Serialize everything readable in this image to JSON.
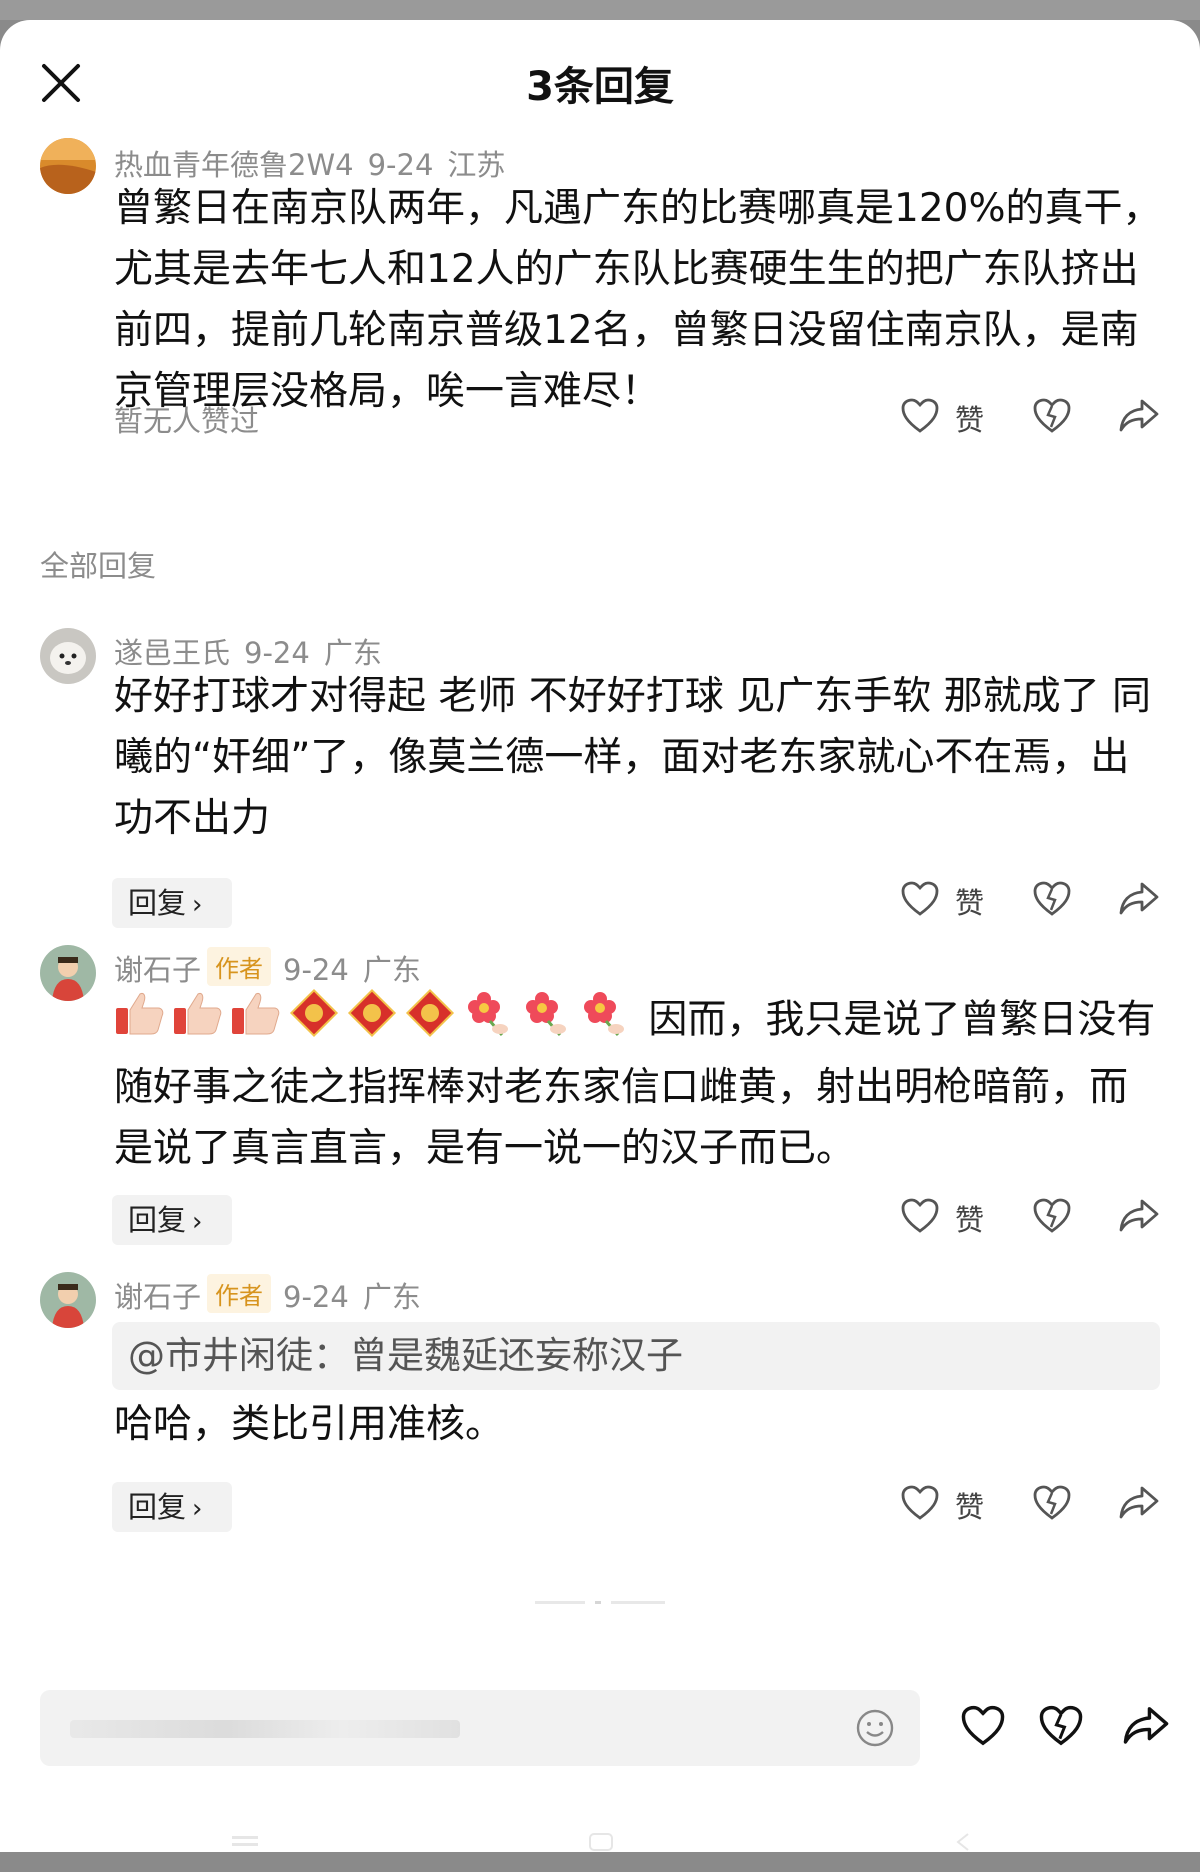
{
  "header": {
    "title": "3条回复"
  },
  "main_comment": {
    "user": "热血青年德鲁2W4",
    "date": "9-24",
    "location": "江苏",
    "text": "曾繁日在南京队两年，凡遇广东的比赛哪真是120%的真干，尤其是去年七人和12人的广东队比赛硬生生的把广东队挤出前四，提前几轮南京普级12名，曾繁日没留住南京队，是南京管理层没格局，唉一言难尽！",
    "likes_text": "暂无人赞过",
    "like_label": "赞"
  },
  "section_label": "全部回复",
  "replies": [
    {
      "user": "遂邑王氏",
      "date": "9-24",
      "location": "广东",
      "text": "好好打球才对得起 老师 不好好打球 见广东手软 那就成了 同曦的“奸细”了，像莫兰德一样，面对老东家就心不在焉，出功不出力",
      "reply_label": "回复",
      "like_label": "赞"
    },
    {
      "user": "谢石子",
      "badge": "作者",
      "date": "9-24",
      "location": "广东",
      "text": "因而，我只是说了曾繁日没有随好事之徒之指挥棒对老东家信口雌黄，射出明枪暗箭，而是说了真言直言，是有一说一的汉子而已。",
      "emoji_icons": [
        "thumbs-up-icon",
        "thumbs-up-icon",
        "thumbs-up-icon",
        "fu-icon",
        "fu-icon",
        "fu-icon",
        "flower-icon",
        "flower-icon",
        "flower-icon"
      ],
      "reply_label": "回复",
      "like_label": "赞"
    },
    {
      "user": "谢石子",
      "badge": "作者",
      "date": "9-24",
      "location": "广东",
      "quote": "@市井闲徒：曾是魏延还妄称汉子",
      "text": "哈哈，类比引用准核。",
      "reply_label": "回复",
      "like_label": "赞"
    }
  ],
  "colors": {
    "meta_gray": "#8c8c8c",
    "badge_text": "#d7941e",
    "badge_bg": "#fdf3e0"
  }
}
